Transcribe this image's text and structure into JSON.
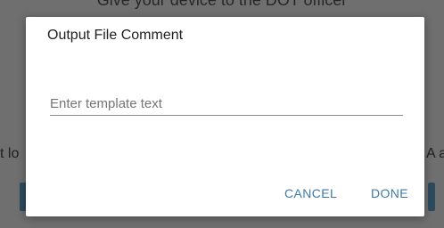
{
  "background": {
    "top_text": "Give your device to the DOT officer",
    "left_text": "t lo",
    "right_text": "A a"
  },
  "dialog": {
    "title": "Output File Comment",
    "input": {
      "placeholder": "Enter template text",
      "value": ""
    },
    "actions": {
      "cancel_label": "CANCEL",
      "done_label": "DONE"
    }
  },
  "colors": {
    "accent": "#3f7aa8",
    "scrim": "#6f6f6f",
    "dialog_bg": "#ffffff",
    "background_button": "#2d4b5e"
  }
}
